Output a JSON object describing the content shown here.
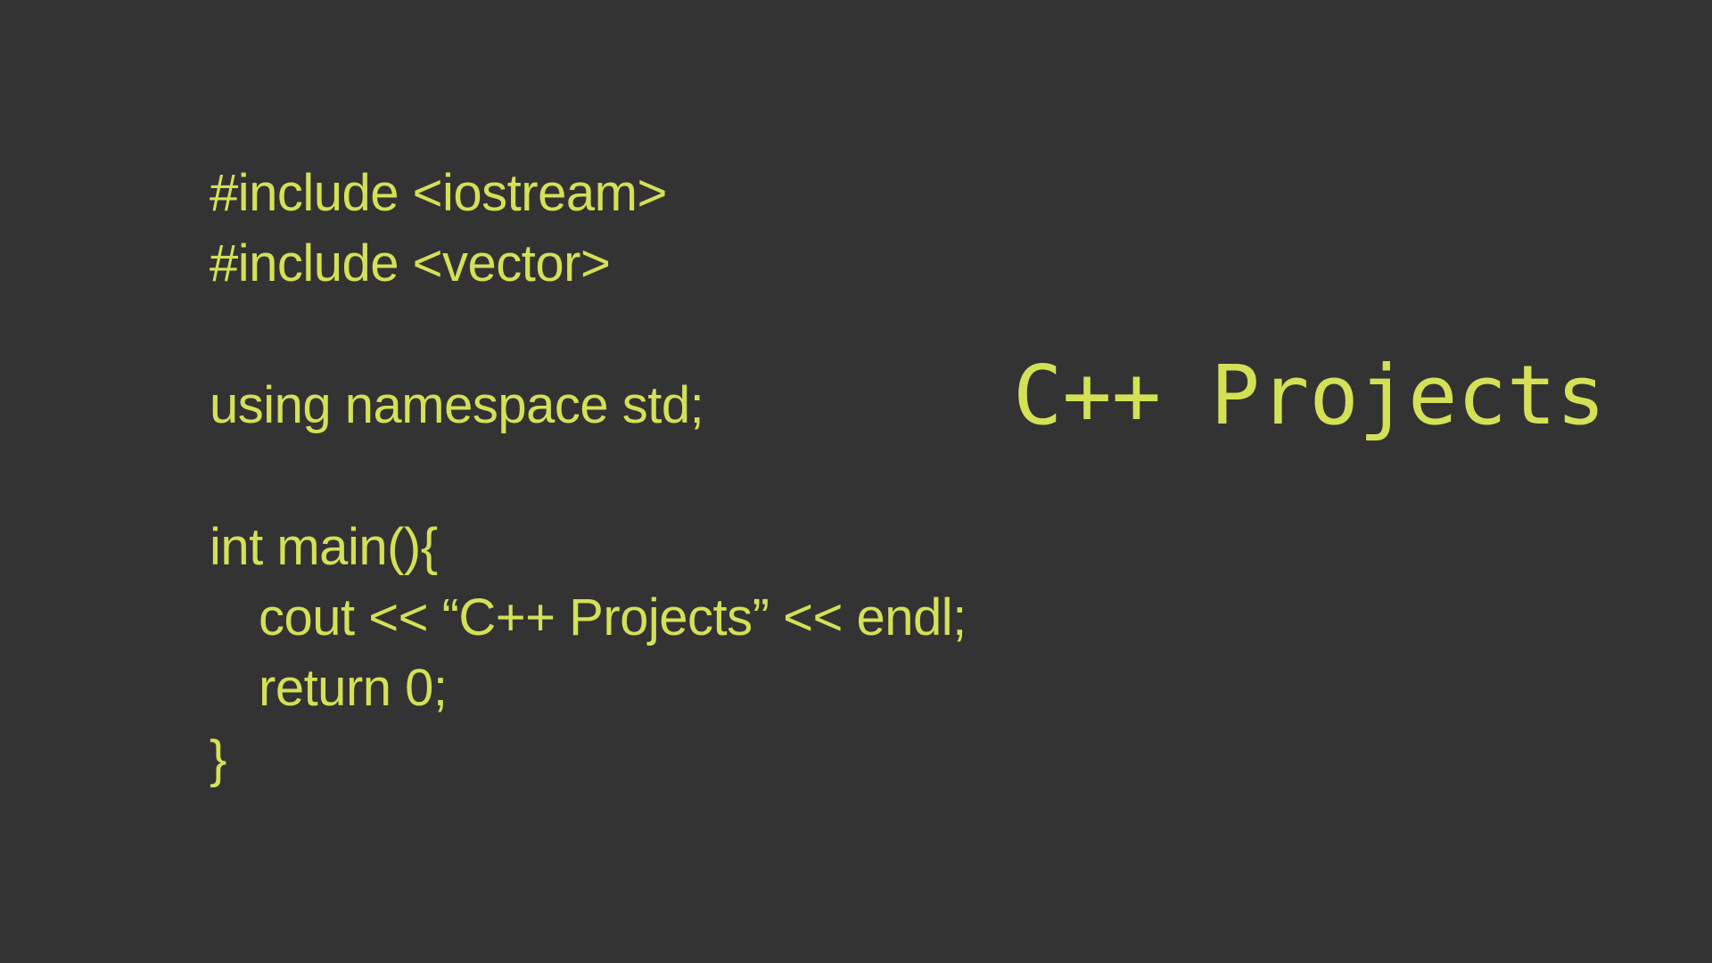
{
  "colors": {
    "background": "#333333",
    "text": "#d4e157"
  },
  "code_lines": [
    "#include <iostream>",
    "#include <vector>",
    "using namespace std;",
    "int main(){",
    "cout << “C++ Projects” << endl;",
    "return 0;",
    "}"
  ],
  "title": "C++ Projects"
}
